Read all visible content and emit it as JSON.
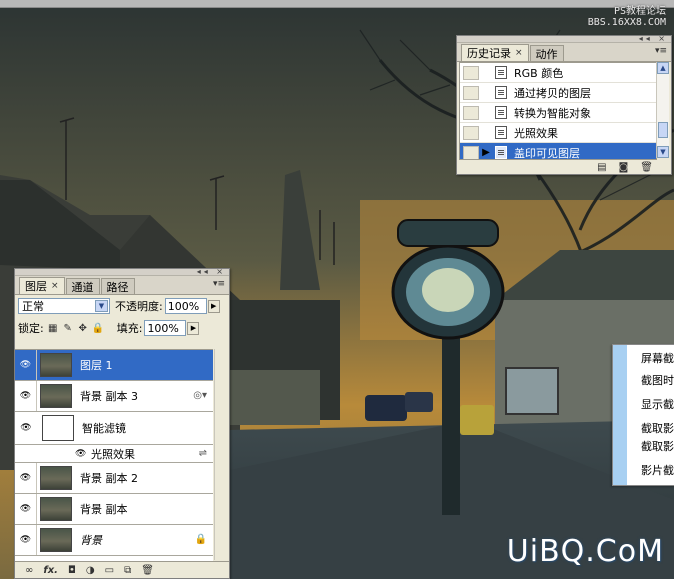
{
  "watermark_top": [
    "PS教程论坛",
    "BBS.16XX8.COM"
  ],
  "watermark_bottom": "UiBQ.CoM",
  "history_panel": {
    "tabs": [
      {
        "label": "历史记录",
        "close": "×"
      },
      {
        "label": "动作"
      }
    ],
    "items": [
      {
        "label": "RGB 颜色"
      },
      {
        "label": "通过拷贝的图层"
      },
      {
        "label": "转换为智能对象"
      },
      {
        "label": "光照效果"
      },
      {
        "label": "盖印可见图层",
        "selected": true
      }
    ]
  },
  "layers_panel": {
    "tabs": [
      {
        "label": "图层",
        "close": "×"
      },
      {
        "label": "通道"
      },
      {
        "label": "路径"
      }
    ],
    "blend_mode": "正常",
    "opacity_label": "不透明度:",
    "opacity_value": "100%",
    "lock_label": "锁定:",
    "fill_label": "填充:",
    "fill_value": "100%",
    "layers": [
      {
        "name": "图层 1",
        "selected": true
      },
      {
        "name": "背景 副本 3"
      },
      {
        "name": "智能滤镜"
      },
      {
        "name": "光照效果"
      },
      {
        "name": "背景 副本 2"
      },
      {
        "name": "背景 副本"
      },
      {
        "name": "背景"
      }
    ],
    "bottom_fx": "fx."
  },
  "context_menu": {
    "items": [
      "屏幕截",
      "截图时",
      "显示截",
      "截取影",
      "截取影",
      "影片截"
    ]
  },
  "colors": {
    "selection": "#316ac5",
    "panel_bg": "#ece9d8",
    "menu_stripe": "#a8d0f2"
  }
}
